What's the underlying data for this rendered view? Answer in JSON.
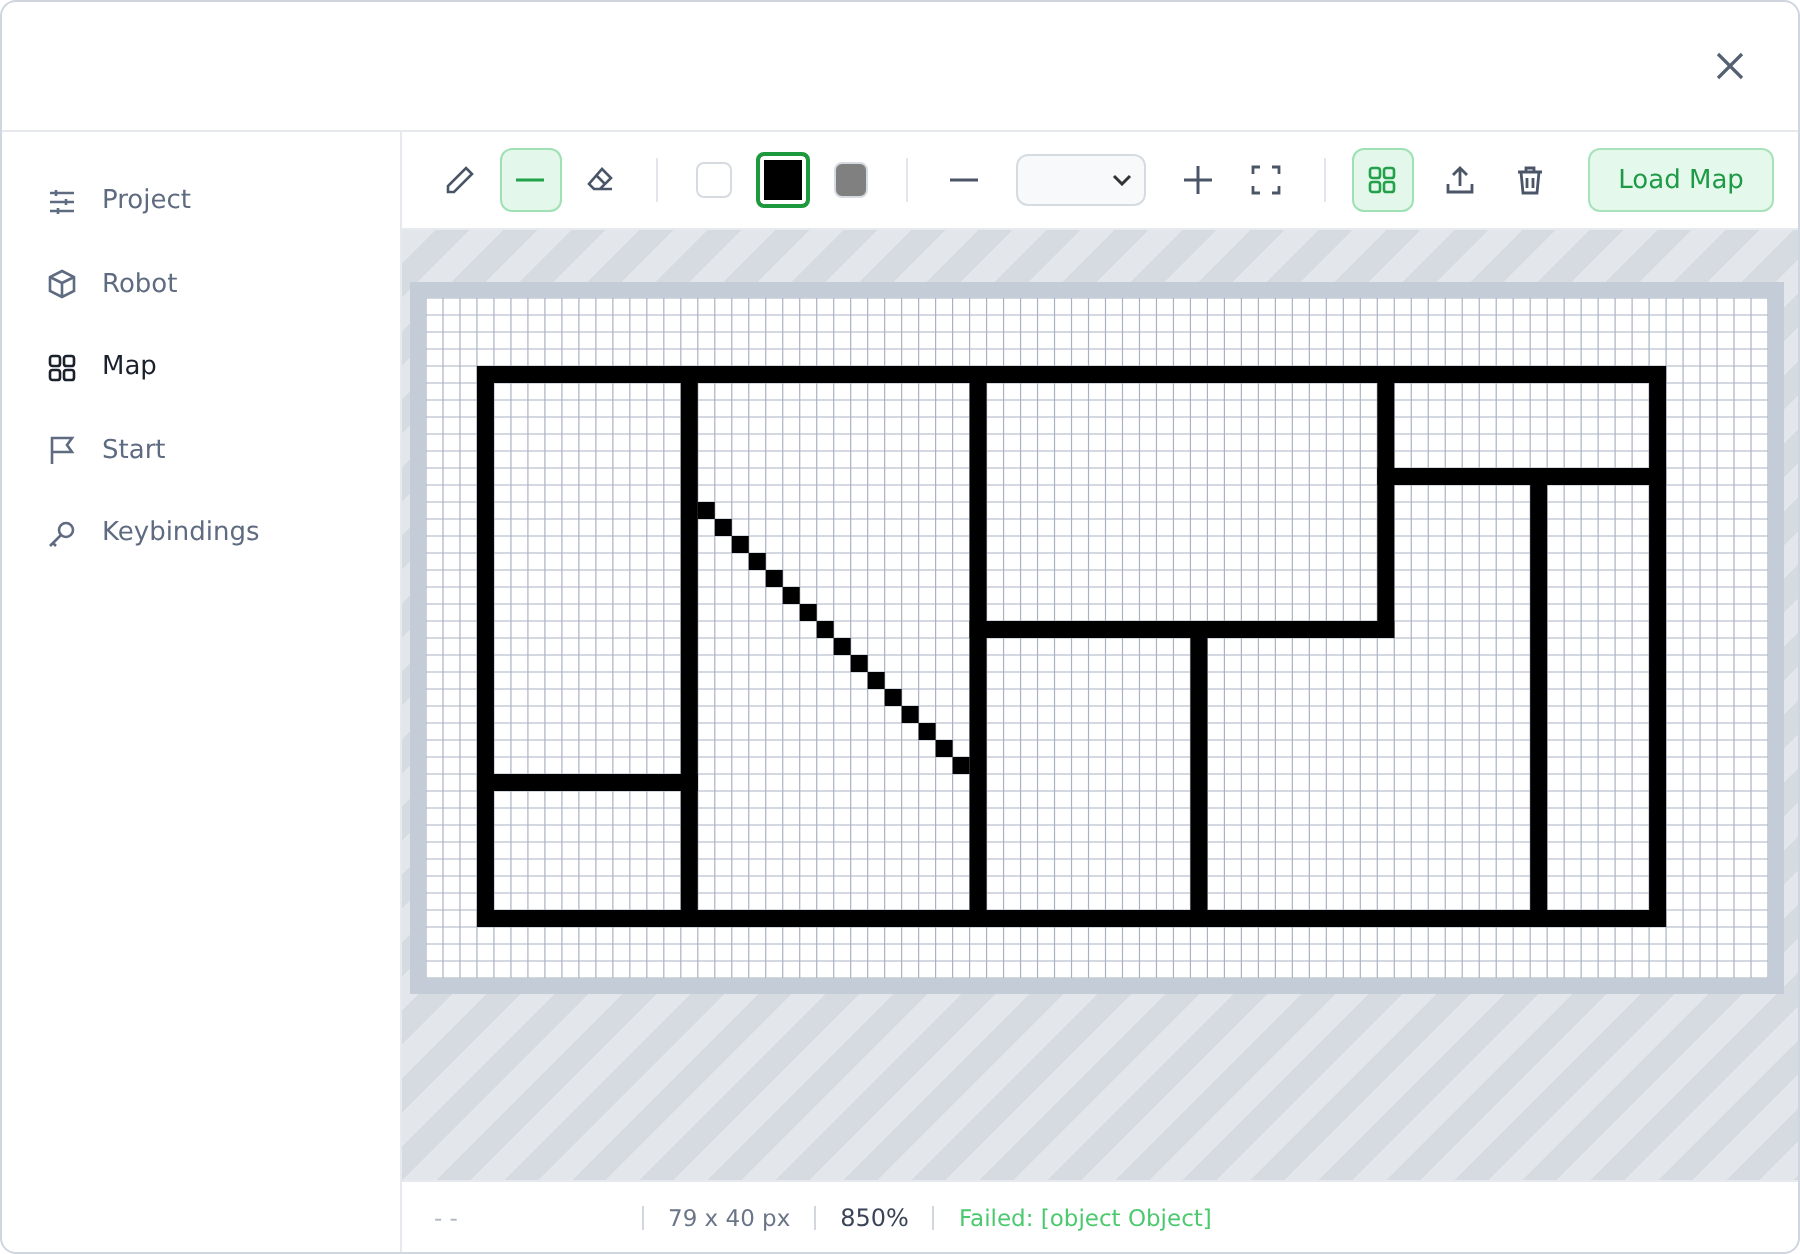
{
  "sidebar": {
    "items": [
      {
        "label": "Project",
        "kind": "sliders",
        "selected": false
      },
      {
        "label": "Robot",
        "kind": "cube",
        "selected": false
      },
      {
        "label": "Map",
        "kind": "grid",
        "selected": true
      },
      {
        "label": "Start",
        "kind": "flag",
        "selected": false
      },
      {
        "label": "Keybindings",
        "kind": "key",
        "selected": false
      }
    ]
  },
  "toolbar": {
    "tools": [
      {
        "kind": "pencil",
        "selected": false
      },
      {
        "kind": "line",
        "selected": true
      },
      {
        "kind": "eraser",
        "selected": false
      }
    ],
    "colors": [
      {
        "color": "#ffffff",
        "selected": false
      },
      {
        "color": "#000000",
        "selected": true
      },
      {
        "color": "#808080",
        "selected": false
      }
    ],
    "grid_toggle": {
      "on": true
    },
    "load_button": "Load Map"
  },
  "status_bar": {
    "position": "- -",
    "size": "79 x 40 px",
    "zoom": "850%",
    "message": "Failed: [object Object]"
  }
}
